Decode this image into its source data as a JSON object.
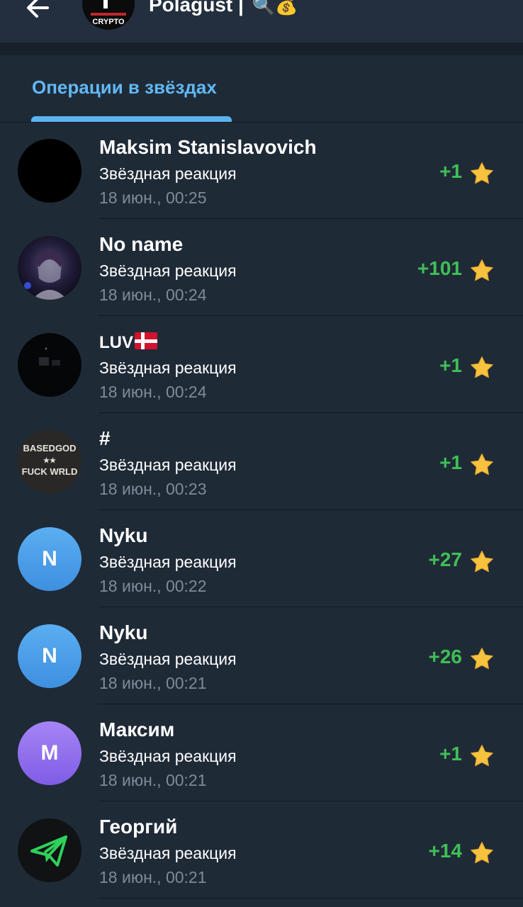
{
  "header": {
    "title": "Polagust |",
    "title_emoji": "🔍💰",
    "avatar_text": "CRYPTO"
  },
  "tabs": [
    {
      "label": "Операции в звёздах",
      "active": true
    }
  ],
  "transactions": [
    {
      "name": "Maksim Stanislavovich",
      "subtitle": "Звёздная реакция",
      "date": "18 июн., 00:25",
      "amount": "+1",
      "avatar": {
        "type": "image",
        "color": "#000000"
      }
    },
    {
      "name": "No name",
      "subtitle": "Звёздная реакция",
      "date": "18 июн., 00:24",
      "amount": "+101",
      "avatar": {
        "type": "image",
        "color": "#1a1630"
      }
    },
    {
      "name": "LUV",
      "name_flag": "denmark-flag",
      "subtitle": "Звёздная реакция",
      "date": "18 июн., 00:24",
      "amount": "+1",
      "avatar": {
        "type": "image",
        "color": "#050607"
      }
    },
    {
      "name": "#",
      "subtitle": "Звёздная реакция",
      "date": "18 июн., 00:23",
      "amount": "+1",
      "avatar": {
        "type": "image",
        "color": "#2a2826",
        "text_top": "BASEDGOD",
        "text_mid": "★★",
        "text_bottom": "FUCK WRLD"
      }
    },
    {
      "name": "Nyku",
      "subtitle": "Звёздная реакция",
      "date": "18 июн., 00:22",
      "amount": "+27",
      "avatar": {
        "type": "letter",
        "letter": "N",
        "color": "#4a9de6"
      }
    },
    {
      "name": "Nyku",
      "subtitle": "Звёздная реакция",
      "date": "18 июн., 00:21",
      "amount": "+26",
      "avatar": {
        "type": "letter",
        "letter": "N",
        "color": "#4a9de6"
      }
    },
    {
      "name": "Максим",
      "subtitle": "Звёздная реакция",
      "date": "18 июн., 00:21",
      "amount": "+1",
      "avatar": {
        "type": "letter",
        "letter": "M",
        "color": "#8f6bea"
      }
    },
    {
      "name": "Георгий",
      "subtitle": "Звёздная реакция",
      "date": "18 июн., 00:21",
      "amount": "+14",
      "avatar": {
        "type": "image",
        "color": "#101214",
        "icon": "paper-plane-icon"
      }
    }
  ],
  "colors": {
    "background": "#1f2a37",
    "accent": "#62b8f3",
    "amount_positive": "#3fbf55",
    "secondary_text": "#7f8b99",
    "star": "#f7c33f"
  }
}
